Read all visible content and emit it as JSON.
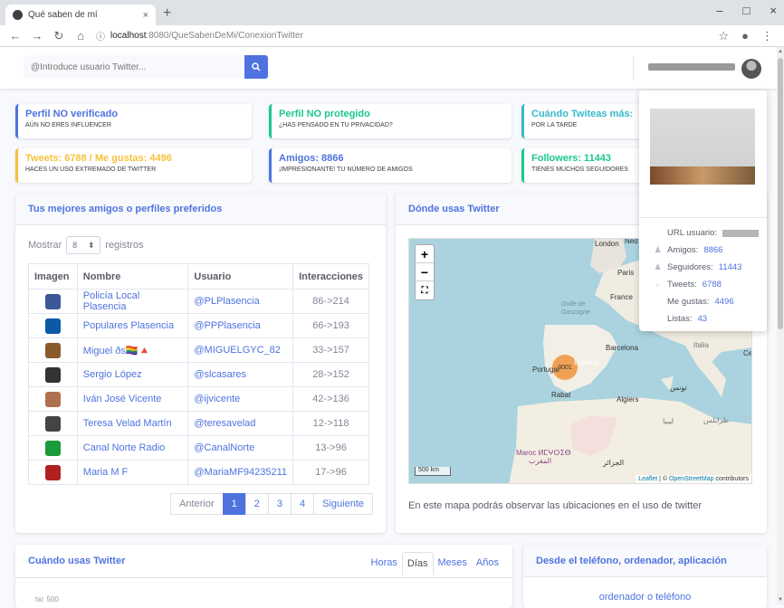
{
  "browser": {
    "tab_title": "Qué saben de mí",
    "tab_close": "×",
    "new_tab": "+",
    "win_min": "–",
    "win_max": "□",
    "win_close": "×",
    "url_host": "localhost",
    "url_path": ":8080/QueSabenDeMi/ConexionTwitter"
  },
  "search": {
    "placeholder": "@Introduce usuario Twitter..."
  },
  "stats": [
    {
      "title": "Perfil NO verificado",
      "sub": "AÚN NO ERES INFLUENCER",
      "color": "#4e73df"
    },
    {
      "title": "Perfil NO protegido",
      "sub": "¿HAS PENSADO EN TU PRIVACIDAD?",
      "color": "#1cc88a"
    },
    {
      "title": "Cuándo Twiteas más:",
      "sub": "POR LA TARDE",
      "color": "#36b9cc"
    },
    {
      "title": "Tweets: 6788 / Me gustas: 4496",
      "sub": "HACES UN USO EXTREMADO DE TWITTER",
      "color": "#f6c23e"
    },
    {
      "title": "Amigos: 8866",
      "sub": "¡IMPRESIONANTE! TU NÚMERO DE AMIGOS",
      "color": "#4e73df"
    },
    {
      "title": "Followers: 11443",
      "sub": "TIENES MUCHOS SEGUIDORES",
      "color": "#1cc88a"
    }
  ],
  "friends": {
    "title": "Tus mejores amigos o perfiles preferidos",
    "show_label": "Mostrar",
    "show_value": "8",
    "records_label": "registros",
    "headers": [
      "Imagen",
      "Nombre",
      "Usuario",
      "Interacciones"
    ],
    "rows": [
      {
        "name": "Policía Local Plasencia",
        "user": "@PLPlasencia",
        "inter": "86->214",
        "icon": "police-badge-icon",
        "color": "#3b5998"
      },
      {
        "name": "Populares Plasencia",
        "user": "@PPPlasencia",
        "inter": "66->193",
        "icon": "pp-logo-icon",
        "color": "#0a5aa8"
      },
      {
        "name": "Miguel ðs🏳️‍🌈🔺",
        "user": "@MIGUELGYC_82",
        "inter": "33->157",
        "icon": "user-photo-icon",
        "color": "#8b5a2b"
      },
      {
        "name": "Sergio López",
        "user": "@slcasares",
        "inter": "28->152",
        "icon": "user-photo-icon",
        "color": "#333333"
      },
      {
        "name": "Iván José Vicente",
        "user": "@ijvicente",
        "inter": "42->136",
        "icon": "user-photo-icon",
        "color": "#b07050"
      },
      {
        "name": "Teresa Velad Martín",
        "user": "@teresavelad",
        "inter": "12->118",
        "icon": "user-photo-icon",
        "color": "#444444"
      },
      {
        "name": "Canal Norte Radio",
        "user": "@CanalNorte",
        "inter": "13->96",
        "icon": "cn-logo-icon",
        "color": "#1a9b3a"
      },
      {
        "name": "Maria M F",
        "user": "@MariaMF94235211",
        "inter": "17->96",
        "icon": "user-photo-icon",
        "color": "#b02020"
      }
    ],
    "pager": {
      "prev": "Anterior",
      "pages": [
        "1",
        "2",
        "3",
        "4"
      ],
      "next": "Siguiente",
      "active": "1"
    }
  },
  "map": {
    "title": "Dónde usas Twitter",
    "zoom_in": "+",
    "zoom_out": "−",
    "fullscreen": "⛶",
    "note": "En este mapa podrás observar las ubicaciones en el uso de twitter",
    "scale": "500 km",
    "attrib_leaflet": "Leaflet",
    "attrib_sep": " | © ",
    "attrib_osm": "OpenStreetMap",
    "attrib_tail": " contributors",
    "cluster_count": "3001",
    "labels": {
      "london": "London",
      "nl": "Ned",
      "paris": "Paris",
      "france": "France",
      "espana": "España",
      "portugal": "Portugal",
      "barcelona": "Barcelona",
      "italia": "Italia",
      "rabat": "Rabat",
      "algiers": "Algiers",
      "maroc": "Maroc ⵍⵎⵖⵔⵉⴱ",
      "maghrib": "المغرب",
      "jazair": "الجزائر",
      "tunis": "تونس",
      "tarabulus": "طرابلس",
      "golfe": "Golfe de Gascogne",
      "ce": "Ce"
    }
  },
  "profile": {
    "url_label": "URL usuario:",
    "friends_label": "Amigos:",
    "friends": "8866",
    "followers_label": "Seguidores:",
    "followers": "11443",
    "tweets_label": "Tweets:",
    "tweets": "6788",
    "likes_label": "Me gustas:",
    "likes": "4496",
    "lists_label": "Listas:",
    "lists": "43"
  },
  "usage": {
    "title": "Cuándo usas Twitter",
    "tabs": [
      "Horas",
      "Días",
      "Meses",
      "Años"
    ],
    "active_tab": "Días",
    "axis_label": "tw: 500"
  },
  "devices": {
    "title": "Desde el teléfono, ordenador, aplicación",
    "link": "ordenador o teléfono"
  }
}
